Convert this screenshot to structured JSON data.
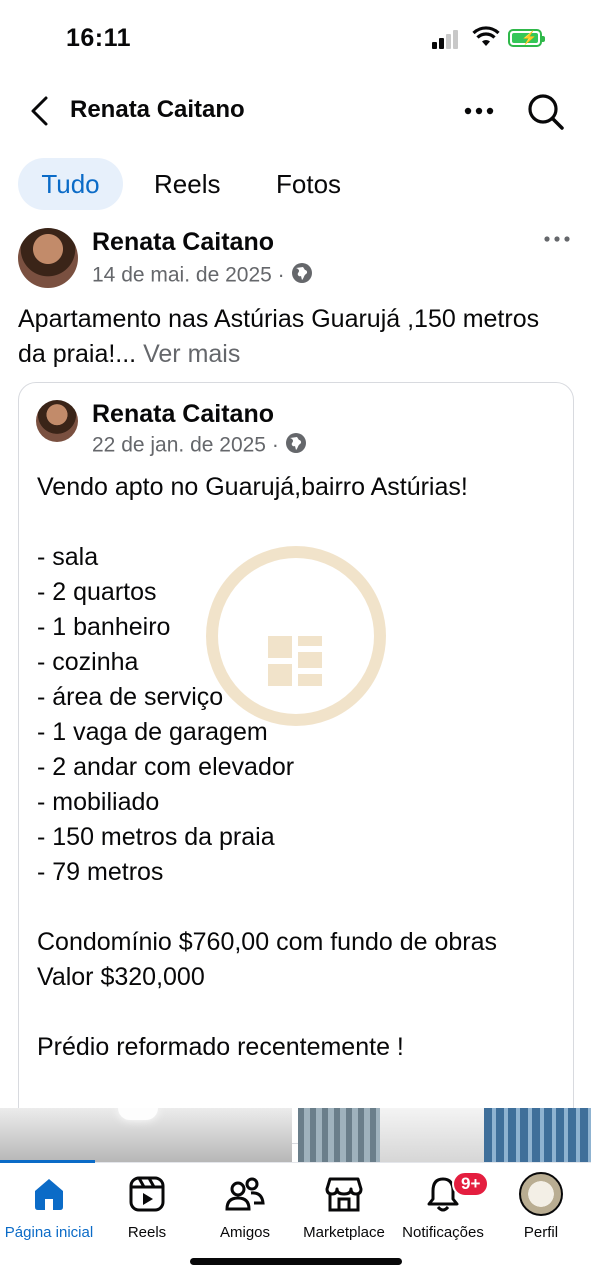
{
  "status_bar": {
    "time": "16:11"
  },
  "header": {
    "title": "Renata Caitano"
  },
  "tabs": [
    {
      "label": "Tudo",
      "active": true
    },
    {
      "label": "Reels",
      "active": false
    },
    {
      "label": "Fotos",
      "active": false
    }
  ],
  "post": {
    "author": "Renata Caitano",
    "date": "14 de mai. de 2025",
    "separator": "·",
    "text": "Apartamento nas Astúrias Guarujá ,150 metros da praia!...",
    "see_more": "Ver mais"
  },
  "shared_post": {
    "author": "Renata Caitano",
    "date": "22 de jan. de 2025",
    "separator": "·",
    "body": "Vendo apto no Guarujá,bairro Astúrias!\n\n- sala\n- 2 quartos\n- 1 banheiro\n- cozinha\n- área de serviço\n- 1 vaga de garagem\n- 2 andar com elevador\n- mobiliado\n- 150 metros da praia\n- 79 metros\n\nCondomínio $760,00 com fundo de obras\nValor $320,000\n\nPrédio reformado recentemente !"
  },
  "bottom_nav": [
    {
      "label": "Página inicial",
      "icon": "home-icon",
      "active": true
    },
    {
      "label": "Reels",
      "icon": "reels-icon",
      "active": false
    },
    {
      "label": "Amigos",
      "icon": "friends-icon",
      "active": false
    },
    {
      "label": "Marketplace",
      "icon": "marketplace-icon",
      "active": false
    },
    {
      "label": "Notificações",
      "icon": "bell-icon",
      "active": false,
      "badge": "9+"
    },
    {
      "label": "Perfil",
      "icon": "profile-avatar",
      "active": false
    }
  ],
  "colors": {
    "accent": "#0b6bc7",
    "tab_active_bg": "#e7f0fb",
    "badge": "#e41e3f",
    "muted": "#65676b"
  }
}
